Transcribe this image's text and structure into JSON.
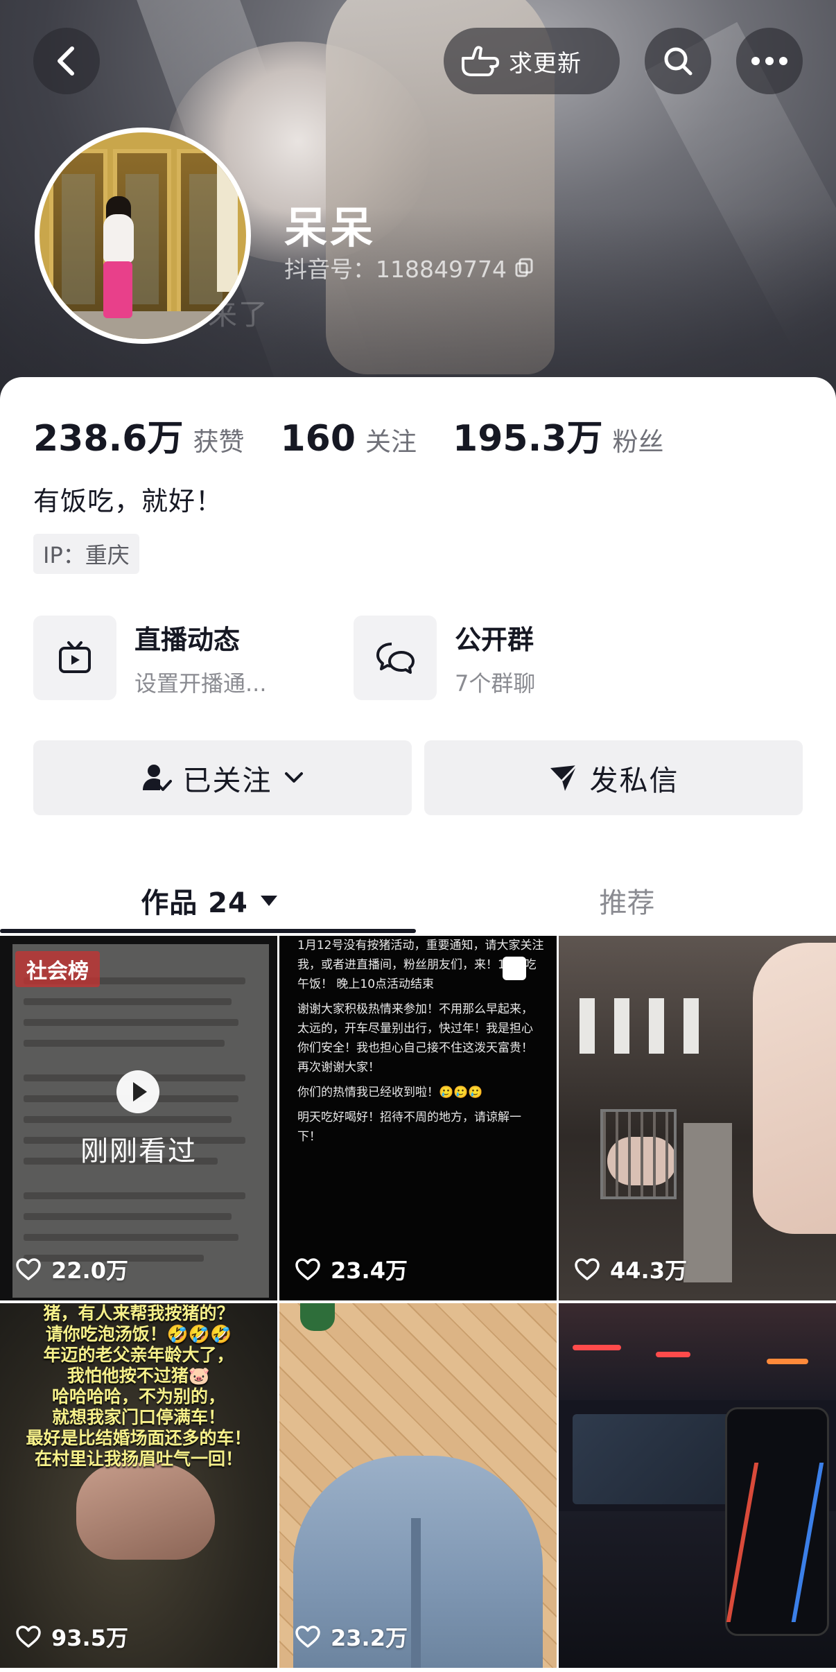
{
  "header": {
    "update_label": "求更新",
    "nickname": "呆呆",
    "douyin_id": "抖音号：118849774",
    "banner_overlay_text": "来了"
  },
  "stats": [
    {
      "value": "238.6万",
      "label": "获赞"
    },
    {
      "value": "160",
      "label": "关注"
    },
    {
      "value": "195.3万",
      "label": "粉丝"
    }
  ],
  "profile": {
    "bio": "有饭吃，就好！",
    "ip": "IP：重庆"
  },
  "entries": {
    "live": {
      "title": "直播动态",
      "subtitle": "设置开播通..."
    },
    "group": {
      "title": "公开群",
      "subtitle": "7个群聊"
    }
  },
  "actions": {
    "followed_label": "已关注",
    "message_label": "发私信"
  },
  "tabs": {
    "works_label": "作品 24",
    "recommend_label": "推荐"
  },
  "videos": [
    {
      "likes": "22.0万",
      "badge": "社会榜",
      "overlay": "刚刚看过"
    },
    {
      "likes": "23.4万",
      "text": [
        "1月12号没有按猪活动，重要通知，请大家关注我，或者进直播间，粉丝朋友们，来！12点吃午饭！ 晚上10点活动结束",
        "谢谢大家积极热情来参加！不用那么早起来，太远的，开车尽量别出行，快过年！我是担心你们安全！我也担心自己接不住这泼天富贵！再次谢谢大家！",
        "你们的热情我已经收到啦！🥲🥲🥲",
        "明天吃好喝好！招待不周的地方，请谅解一下！"
      ]
    },
    {
      "likes": "44.3万"
    },
    {
      "likes": "93.5万",
      "caption": [
        "猪，有人来帮我按猪的？",
        "请你吃泡汤饭！🤣🤣🤣",
        "年迈的老父亲年龄大了，",
        "我怕他按不过猪🐷",
        "哈哈哈哈，不为别的，",
        "就想我家门口停满车！",
        "最好是比结婚场面还多的车！",
        "在村里让我扬眉吐气一回！"
      ]
    },
    {
      "likes": "23.2万"
    },
    {
      "likes": ""
    }
  ]
}
